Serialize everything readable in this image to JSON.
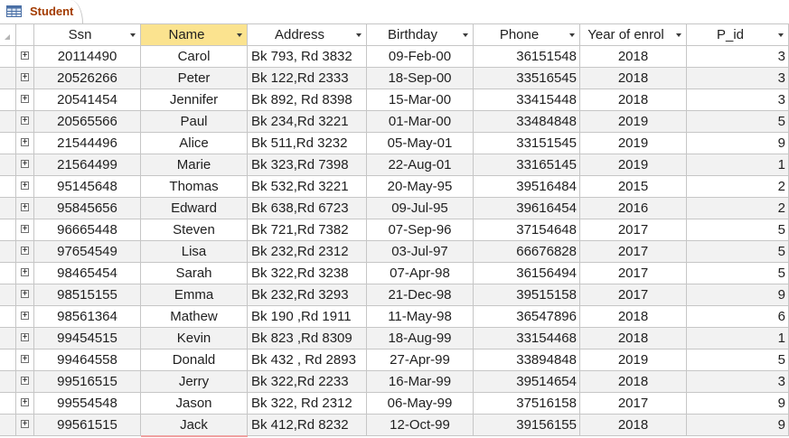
{
  "tab": {
    "label": "Student"
  },
  "columns": [
    {
      "key": "ssn",
      "label": "Ssn"
    },
    {
      "key": "name",
      "label": "Name"
    },
    {
      "key": "address",
      "label": "Address"
    },
    {
      "key": "birthday",
      "label": "Birthday"
    },
    {
      "key": "phone",
      "label": "Phone"
    },
    {
      "key": "year",
      "label": "Year of enrol"
    },
    {
      "key": "pid",
      "label": "P_id"
    }
  ],
  "selected_column": "name",
  "rows": [
    {
      "ssn": "20114490",
      "name": "Carol",
      "address": "Bk 793, Rd 3832",
      "birthday": "09-Feb-00",
      "phone": "36151548",
      "year": "2018",
      "pid": "3"
    },
    {
      "ssn": "20526266",
      "name": "Peter",
      "address": "Bk 122,Rd 2333",
      "birthday": "18-Sep-00",
      "phone": "33516545",
      "year": "2018",
      "pid": "3"
    },
    {
      "ssn": "20541454",
      "name": "Jennifer",
      "address": "Bk 892, Rd 8398",
      "birthday": "15-Mar-00",
      "phone": "33415448",
      "year": "2018",
      "pid": "3"
    },
    {
      "ssn": "20565566",
      "name": "Paul",
      "address": "Bk 234,Rd 3221",
      "birthday": "01-Mar-00",
      "phone": "33484848",
      "year": "2019",
      "pid": "5"
    },
    {
      "ssn": "21544496",
      "name": "Alice",
      "address": "Bk 511,Rd 3232",
      "birthday": "05-May-01",
      "phone": "33151545",
      "year": "2019",
      "pid": "9"
    },
    {
      "ssn": "21564499",
      "name": "Marie",
      "address": "Bk 323,Rd 7398",
      "birthday": "22-Aug-01",
      "phone": "33165145",
      "year": "2019",
      "pid": "1"
    },
    {
      "ssn": "95145648",
      "name": "Thomas",
      "address": "Bk 532,Rd 3221",
      "birthday": "20-May-95",
      "phone": "39516484",
      "year": "2015",
      "pid": "2"
    },
    {
      "ssn": "95845656",
      "name": "Edward",
      "address": "Bk 638,Rd 6723",
      "birthday": "09-Jul-95",
      "phone": "39616454",
      "year": "2016",
      "pid": "2"
    },
    {
      "ssn": "96665448",
      "name": "Steven",
      "address": "Bk 721,Rd 7382",
      "birthday": "07-Sep-96",
      "phone": "37154648",
      "year": "2017",
      "pid": "5"
    },
    {
      "ssn": "97654549",
      "name": "Lisa",
      "address": "Bk 232,Rd 2312",
      "birthday": "03-Jul-97",
      "phone": "66676828",
      "year": "2017",
      "pid": "5"
    },
    {
      "ssn": "98465454",
      "name": "Sarah",
      "address": "Bk 322,Rd 3238",
      "birthday": "07-Apr-98",
      "phone": "36156494",
      "year": "2017",
      "pid": "5"
    },
    {
      "ssn": "98515155",
      "name": "Emma",
      "address": "Bk 232,Rd 3293",
      "birthday": "21-Dec-98",
      "phone": "39515158",
      "year": "2017",
      "pid": "9"
    },
    {
      "ssn": "98561364",
      "name": "Mathew",
      "address": "Bk 190 ,Rd 1911",
      "birthday": "11-May-98",
      "phone": "36547896",
      "year": "2018",
      "pid": "6"
    },
    {
      "ssn": "99454515",
      "name": "Kevin",
      "address": "Bk 823 ,Rd 8309",
      "birthday": "18-Aug-99",
      "phone": "33154468",
      "year": "2018",
      "pid": "1"
    },
    {
      "ssn": "99464558",
      "name": "Donald",
      "address": "Bk 432 , Rd 2893",
      "birthday": "27-Apr-99",
      "phone": "33894848",
      "year": "2019",
      "pid": "5"
    },
    {
      "ssn": "99516515",
      "name": "Jerry",
      "address": "Bk 322,Rd 2233",
      "birthday": "16-Mar-99",
      "phone": "39514654",
      "year": "2018",
      "pid": "3"
    },
    {
      "ssn": "99554548",
      "name": "Jason",
      "address": "Bk 322, Rd 2312",
      "birthday": "06-May-99",
      "phone": "37516158",
      "year": "2017",
      "pid": "9"
    },
    {
      "ssn": "99561515",
      "name": "Jack",
      "address": "Bk 412,Rd 8232",
      "birthday": "12-Oct-99",
      "phone": "39156155",
      "year": "2018",
      "pid": "9"
    }
  ],
  "icons": {
    "tab_icon": "table-icon",
    "expand": "plus-box-icon",
    "sort": "dropdown-arrow-icon",
    "select_all": "select-all-corner-icon"
  },
  "colors": {
    "tab_text": "#a33b00",
    "selected_header": "#fbe38f",
    "alt_row": "#f2f2f2",
    "gridline": "#c6c6c6"
  }
}
